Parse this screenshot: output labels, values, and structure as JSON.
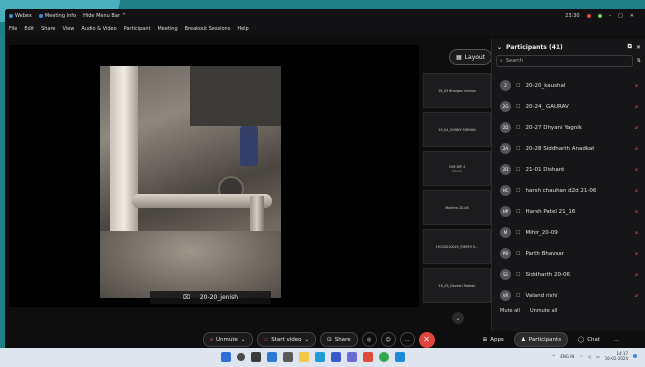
{
  "titlebar": {
    "app": "Webex",
    "meeting_info": "Meeting Info",
    "hide_menu": "Hide Menu Bar",
    "time": "23:30"
  },
  "menu": [
    "File",
    "Edit",
    "Share",
    "View",
    "Audio & Video",
    "Participant",
    "Meeting",
    "Breakout Sessions",
    "Help"
  ],
  "stage": {
    "active_speaker": "20-20_jenish",
    "layout_label": "Layout"
  },
  "tiles": [
    {
      "name": "18_03 Bhargav shrivas"
    },
    {
      "name": "19_04_SUNNY SIMHAN"
    },
    {
      "name": "CHE DIP 4",
      "sub": "Ownet"
    },
    {
      "name": "Mahitra 20-06"
    },
    {
      "name": "19120010024_RIMITH S..."
    },
    {
      "name": "19_05_Devesh Rakesh"
    }
  ],
  "participants": {
    "title": "Participants (41)",
    "search_placeholder": "Search",
    "items": [
      {
        "initials": "2",
        "name": "20-20_kaushal"
      },
      {
        "initials": "2G",
        "name": "20-24_ GAURAV"
      },
      {
        "initials": "2D",
        "name": "20-27 Dhyani Yagnik"
      },
      {
        "initials": "2A",
        "name": "20-28 Siddharth Anadkat"
      },
      {
        "initials": "2D",
        "name": "21-01 Dishant"
      },
      {
        "initials": "HC",
        "name": "harsh chauhan d2d 21-06"
      },
      {
        "initials": "HP",
        "name": "Harsh Patel 21_16"
      },
      {
        "initials": "M",
        "name": "Mihir_20-09"
      },
      {
        "initials": "PB",
        "name": "Parth Bhavsar"
      },
      {
        "initials": "S2",
        "name": "Siddharth 20-06"
      },
      {
        "initials": "VR",
        "name": "Valand rishi"
      }
    ],
    "mute_all": "Mute all",
    "unmute_all": "Unmute all"
  },
  "controls": {
    "unmute": "Unmute",
    "start_video": "Start video",
    "share": "Share",
    "apps": "Apps",
    "participants": "Participants",
    "chat": "Chat"
  },
  "taskbar": {
    "lang": "ENG IN",
    "time": "14:17",
    "date": "16-02-2024"
  }
}
